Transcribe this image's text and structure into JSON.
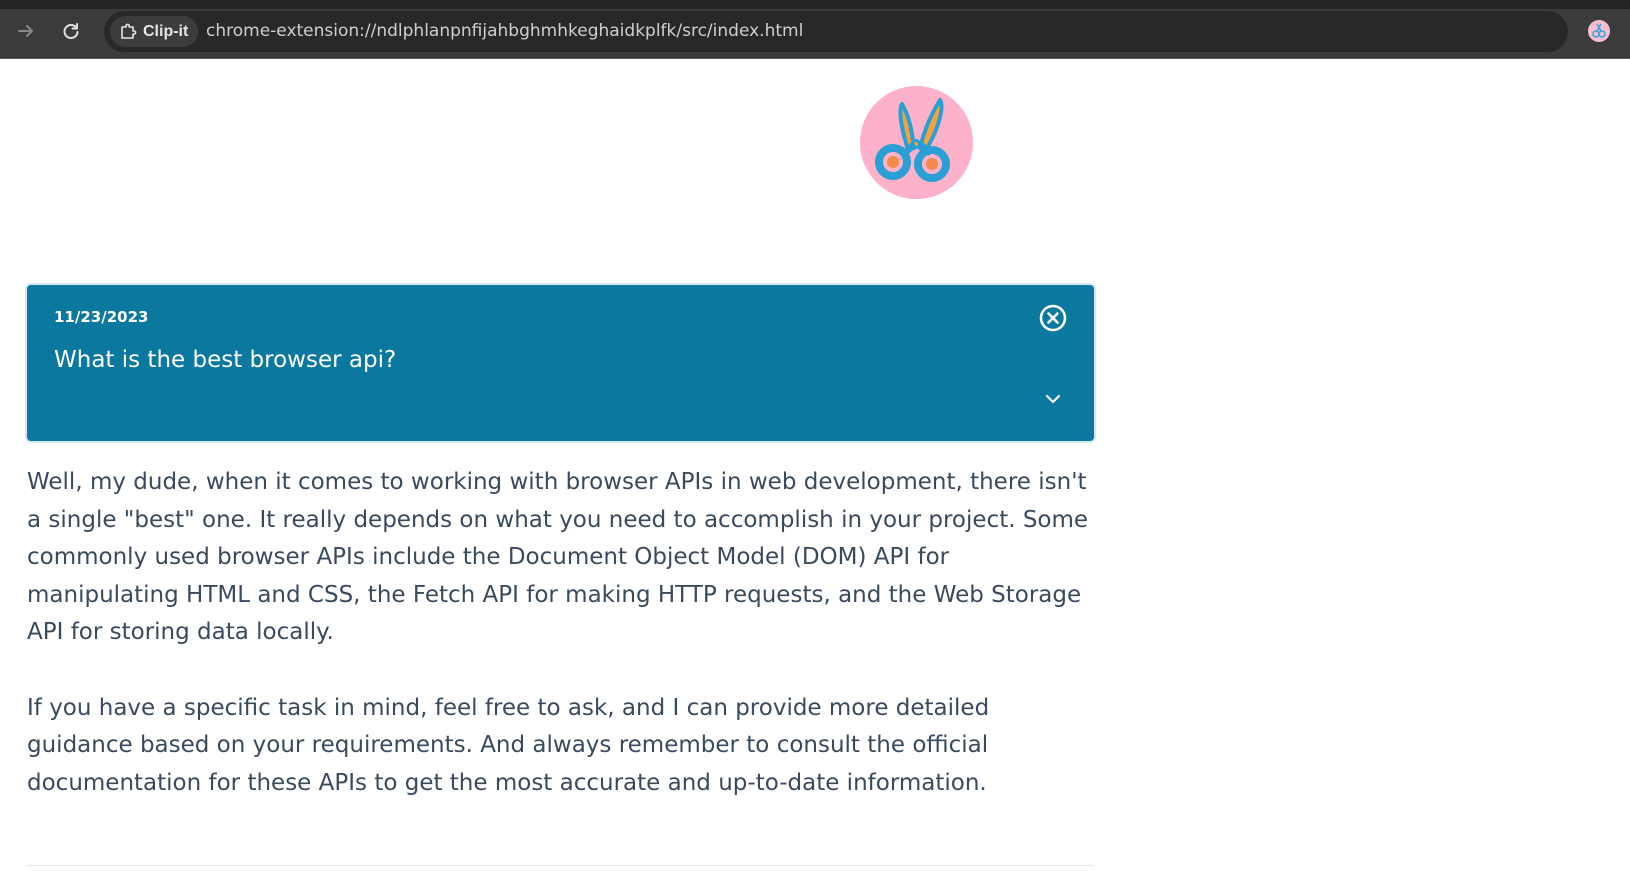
{
  "browser": {
    "extension_chip_label": "Clip-it",
    "url": "chrome-extension://ndlphlanpnfijahbghmhkeghaidkplfk/src/index.html",
    "icons": {
      "forward": "arrow-right-icon",
      "reload": "reload-icon",
      "extension": "puzzle-icon",
      "bookmark": "star-icon",
      "profile": "avatar"
    }
  },
  "app": {
    "logo": "scissors-logo-icon",
    "colors": {
      "card": "#0b789f",
      "logo_bg": "#fdb2c9",
      "text": "#3a4a5e"
    }
  },
  "conversation": {
    "date": "11/23/2023",
    "question": "What is the best browser api?",
    "answer_paragraphs": [
      "Well, my dude, when it comes to working with browser APIs in web development, there isn't a single \"best\" one. It really depends on what you need to accomplish in your project. Some commonly used browser APIs include the Document Object Model (DOM) API for manipulating HTML and CSS, the Fetch API for making HTTP requests, and the Web Storage API for storing data locally.",
      "If you have a specific task in mind, feel free to ask, and I can provide more detailed guidance based on your requirements. And always remember to consult the official documentation for these APIs to get the most accurate and up-to-date information."
    ]
  }
}
